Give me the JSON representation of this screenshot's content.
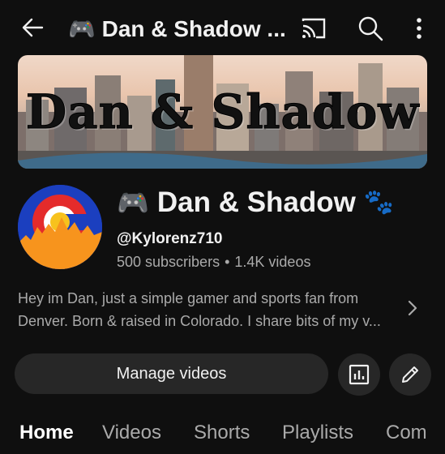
{
  "header": {
    "title": "Dan & Shadow ...",
    "title_emoji": "🎮"
  },
  "banner": {
    "text": "Dan & Shadow"
  },
  "channel": {
    "emoji": "🎮",
    "name": "Dan & Shadow",
    "paw_emoji": "🐾",
    "handle": "@Kylorenz710",
    "subscribers": "500 subscribers",
    "separator": "•",
    "videos": "1.4K videos",
    "description_line1": "Hey im Dan, just a simple gamer and sports fan from",
    "description_line2": "Denver. Born & raised in Colorado. I share bits of my v..."
  },
  "actions": {
    "manage_label": "Manage videos"
  },
  "tabs": [
    {
      "label": "Home",
      "active": true
    },
    {
      "label": "Videos",
      "active": false
    },
    {
      "label": "Shorts",
      "active": false
    },
    {
      "label": "Playlists",
      "active": false
    },
    {
      "label": "Com",
      "active": false
    }
  ],
  "colors": {
    "background": "#0f0f0f",
    "text_primary": "#f1f1f1",
    "text_secondary": "#aaaaaa",
    "button_bg": "#272727",
    "avatar_blue": "#1b3fbf",
    "avatar_orange": "#f7941d"
  },
  "icons": {
    "back": "arrow-left-icon",
    "cast": "cast-icon",
    "search": "search-icon",
    "more": "more-vert-icon",
    "chevron": "chevron-right-icon",
    "analytics": "analytics-icon",
    "edit": "pencil-icon"
  }
}
